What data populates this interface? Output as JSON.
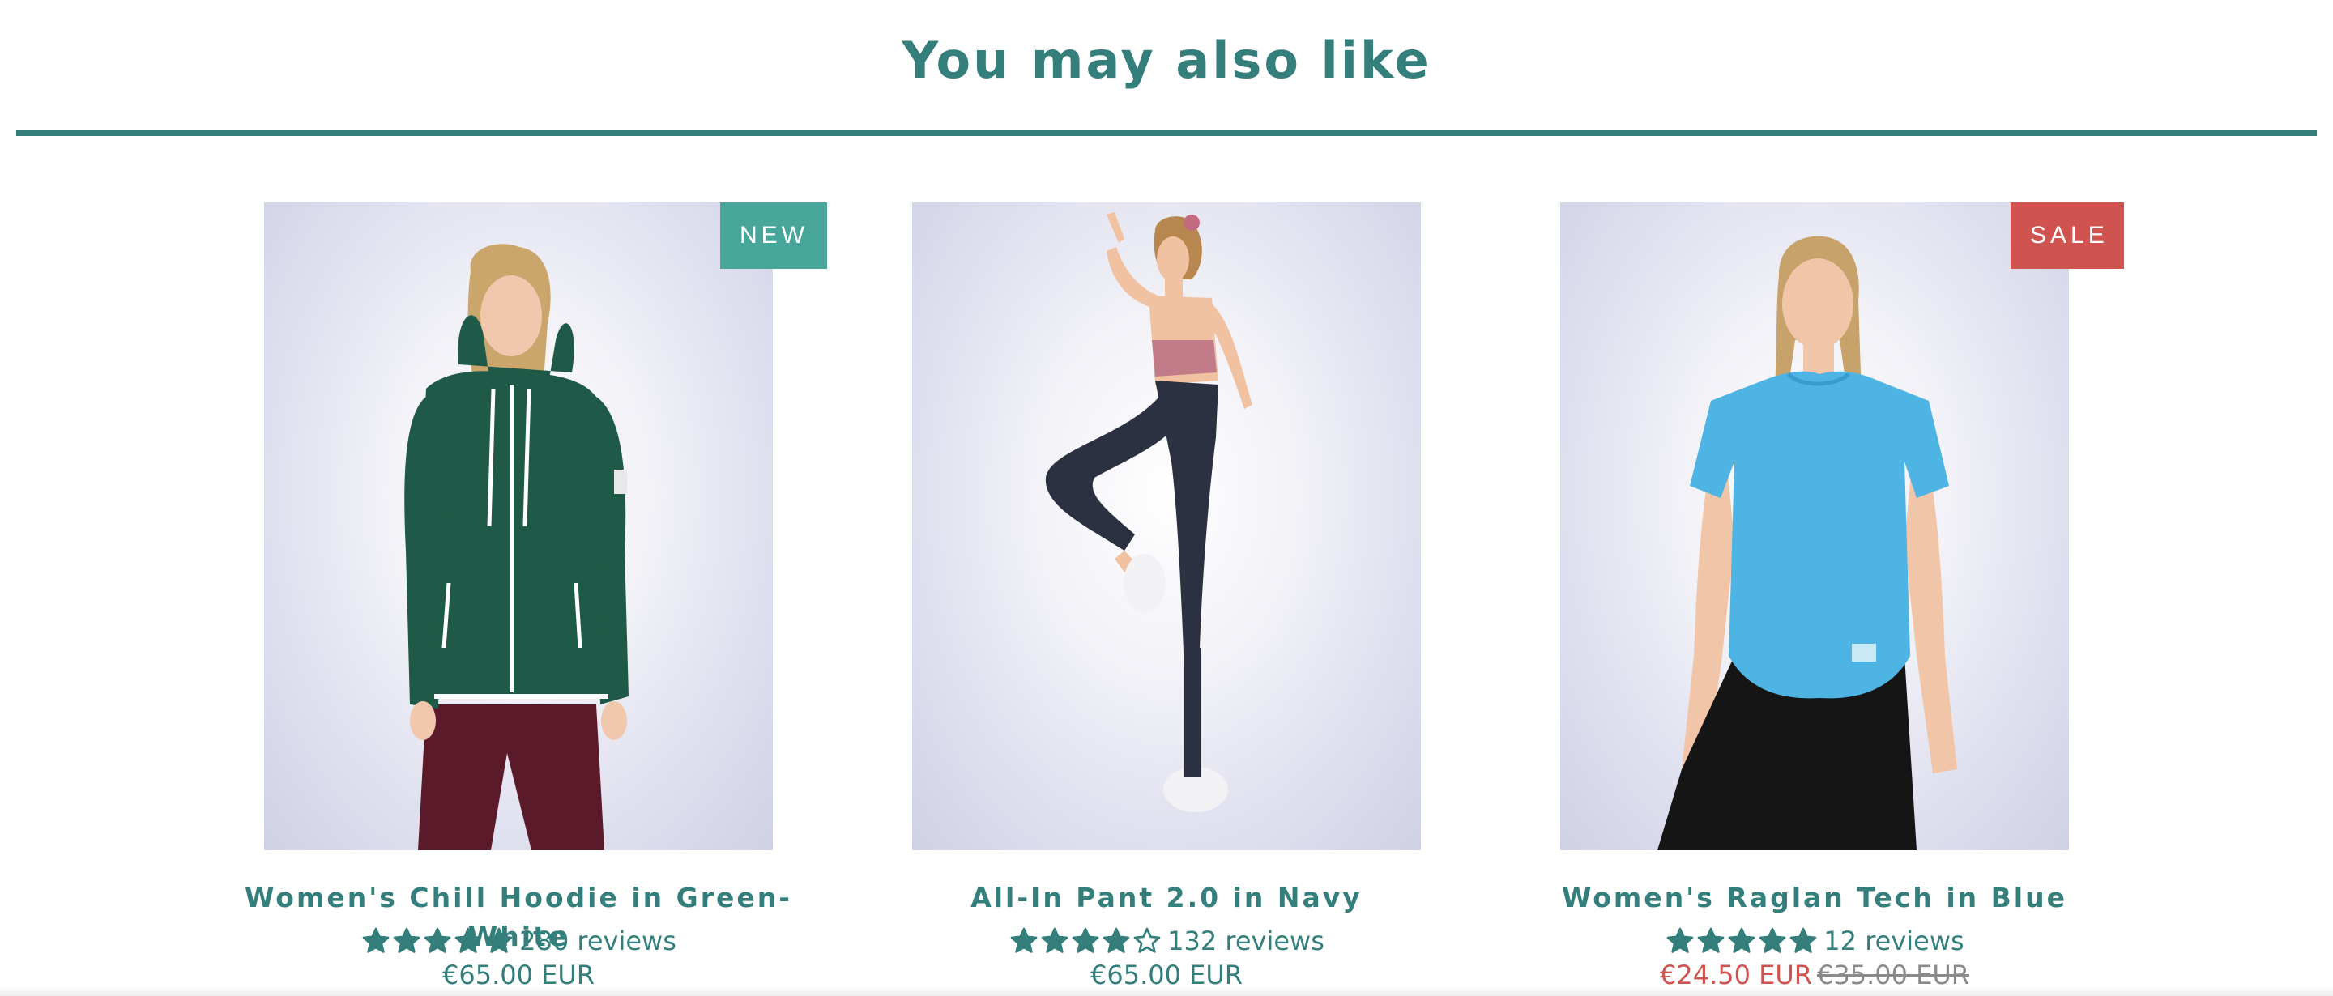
{
  "section": {
    "title": "You may also like"
  },
  "colors": {
    "brand_teal": "#347f7b",
    "badge_new": "#47a599",
    "badge_sale": "#cf534f",
    "compare_price": "#8a8a8a"
  },
  "products": [
    {
      "title": "Women's Chill Hoodie in Green-White",
      "badge": "NEW",
      "rating": 5,
      "reviews": "280 reviews",
      "price": "€65.00 EUR",
      "image_icon": "hoodie-model-photo"
    },
    {
      "title": "All-In Pant 2.0 in Navy",
      "badge": "",
      "rating": 4,
      "reviews": "132 reviews",
      "price": "€65.00 EUR",
      "image_icon": "pant-model-photo"
    },
    {
      "title": "Women's Raglan Tech in Blue",
      "badge": "SALE",
      "rating": 5,
      "reviews": "12 reviews",
      "price": "€24.50 EUR",
      "compare_price": "€35.00 EUR",
      "image_icon": "tee-model-photo"
    }
  ]
}
